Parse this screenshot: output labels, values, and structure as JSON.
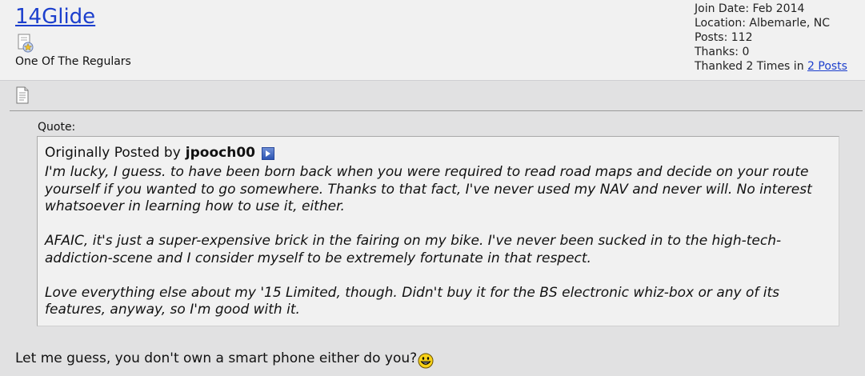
{
  "user": {
    "name": "14Glide",
    "title": "One Of The Regulars",
    "rank_icon": "rank-star-icon",
    "info": {
      "join_date": "Join Date: Feb 2014",
      "location": "Location: Albemarle, NC",
      "posts": "Posts: 112",
      "thanks": "Thanks: 0",
      "thanked_prefix": "Thanked 2 Times in",
      "thanked_link": "2 Posts"
    }
  },
  "post": {
    "icon": "post-document-icon",
    "quote_label": "Quote:",
    "quote": {
      "originally_posted_by": "Originally Posted by",
      "author": "jpooch00",
      "view_post_icon": "view-post-arrow-icon",
      "paragraphs": [
        "I'm lucky, I guess. to have been born back when you were required to read road maps and decide on your route yourself if you wanted to go somewhere. Thanks to that fact, I've never used my NAV and never will. No interest whatsoever in learning how to use it, either.",
        "AFAIC, it's just a super-expensive brick in the fairing on my bike. I've never been sucked in to the high-tech-addiction-scene and I consider myself to be extremely fortunate in that respect.",
        "Love everything else about my '15 Limited, though. Didn't buy it for the BS electronic whiz-box or any of its features, anyway, so I'm good with it."
      ]
    },
    "reply_text": "Let me guess, you don't own a smart phone either do you?",
    "smiley": "grin-smiley-icon"
  },
  "colors": {
    "link": "#1c3fcd",
    "header_bg": "#f1f1f1",
    "page_bg": "#e1e1e2"
  }
}
